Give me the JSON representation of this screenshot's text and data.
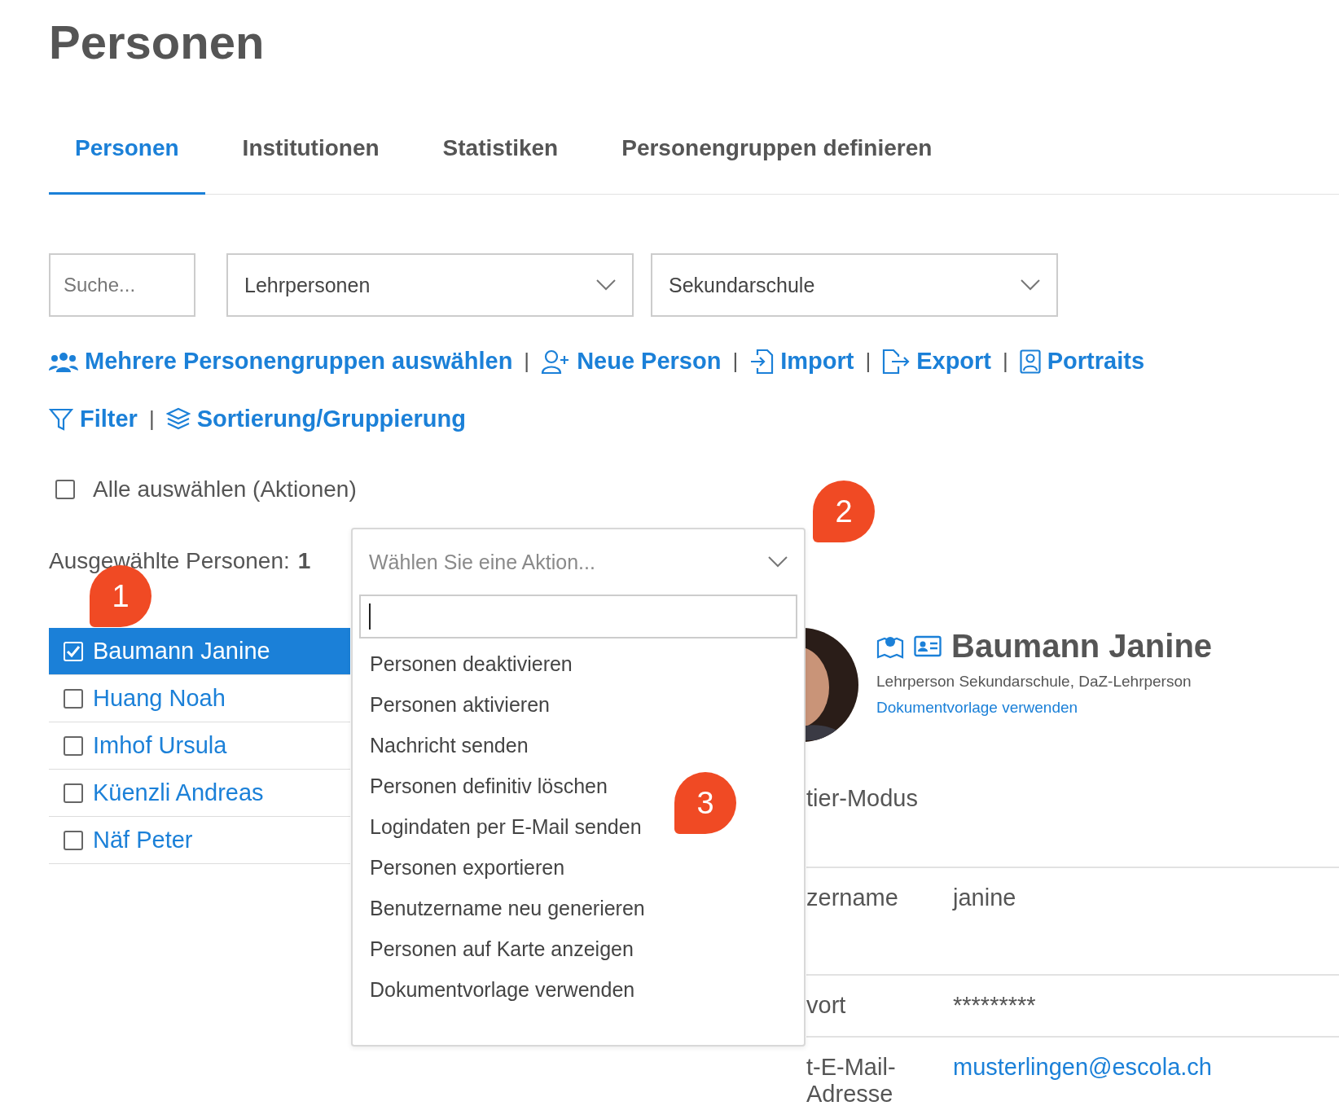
{
  "page_title": "Personen",
  "tabs": [
    {
      "label": "Personen",
      "selected": true
    },
    {
      "label": "Institutionen",
      "selected": false
    },
    {
      "label": "Statistiken",
      "selected": false
    },
    {
      "label": "Personengruppen definieren",
      "selected": false
    }
  ],
  "search": {
    "placeholder": "Suche..."
  },
  "filters": [
    {
      "value": "Lehrpersonen"
    },
    {
      "value": "Sekundarschule"
    }
  ],
  "separator": "|",
  "action_rows": [
    [
      {
        "label": "Mehrere Personengruppen auswählen",
        "kind": "groups"
      },
      {
        "label": "Neue Person",
        "kind": "add-user"
      },
      {
        "label": "Import",
        "kind": "import"
      },
      {
        "label": "Export",
        "kind": "export"
      },
      {
        "label": "Portraits",
        "kind": "portrait"
      }
    ],
    [
      {
        "label": "Filter",
        "kind": "filter"
      },
      {
        "label": "Sortierung/Gruppierung",
        "kind": "layers"
      }
    ]
  ],
  "select_all": {
    "label": "Alle auswählen (Aktionen)",
    "checked": false
  },
  "selection_count": {
    "label": "Ausgewählte Personen:",
    "count": "1"
  },
  "people": [
    {
      "name": "Baumann Janine",
      "checked": true,
      "selected": true
    },
    {
      "name": "Huang Noah",
      "checked": false,
      "selected": false
    },
    {
      "name": "Imhof Ursula",
      "checked": false,
      "selected": false
    },
    {
      "name": "Küenzli Andreas",
      "checked": false,
      "selected": false
    },
    {
      "name": "Näf Peter",
      "checked": false,
      "selected": false
    }
  ],
  "action_dropdown": {
    "placeholder": "Wählen Sie eine Aktion...",
    "expanded": true,
    "options": [
      "Personen deaktivieren",
      "Personen aktivieren",
      "Nachricht senden",
      "Personen definitiv löschen",
      "Logindaten per E-Mail senden",
      "Personen exportieren",
      "Benutzername neu generieren",
      "Personen auf Karte anzeigen",
      "Dokumentvorlage verwenden"
    ]
  },
  "detail": {
    "name": "Baumann Janine",
    "roles": "Lehrperson Sekundarschule, DaZ-Lehrperson",
    "link": "Dokumentvorlage verwenden",
    "mode": "tier-Modus",
    "fields": [
      {
        "label": "zername",
        "value": "janine",
        "kind": "text"
      },
      {
        "label": "vort",
        "value": "*********",
        "kind": "text"
      },
      {
        "label": "t-E-Mail-Adresse",
        "value": "musterlingen@escola.ch",
        "kind": "link"
      }
    ]
  },
  "markers": [
    "1",
    "2",
    "3"
  ]
}
